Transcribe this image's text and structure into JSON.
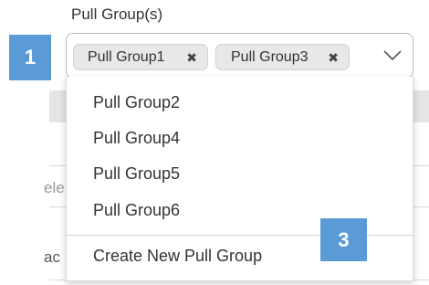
{
  "field": {
    "label": "Pull Group(s)"
  },
  "steps": {
    "badge_1": "1",
    "badge_3": "3"
  },
  "selected_chips": [
    {
      "label": "Pull Group1",
      "remove_glyph": "✖"
    },
    {
      "label": "Pull Group3",
      "remove_glyph": "✖"
    }
  ],
  "dropdown": {
    "options": [
      {
        "label": "Pull Group2"
      },
      {
        "label": "Pull Group4"
      },
      {
        "label": "Pull Group5"
      },
      {
        "label": "Pull Group6"
      }
    ],
    "create_action": "Create New Pull Group",
    "icon": "chevron-down-icon"
  },
  "background": {
    "partial_text_1": "ele",
    "partial_text_2": "ac"
  },
  "colors": {
    "badge": "#5b9bd5",
    "chip_bg": "#e8e8e8"
  }
}
